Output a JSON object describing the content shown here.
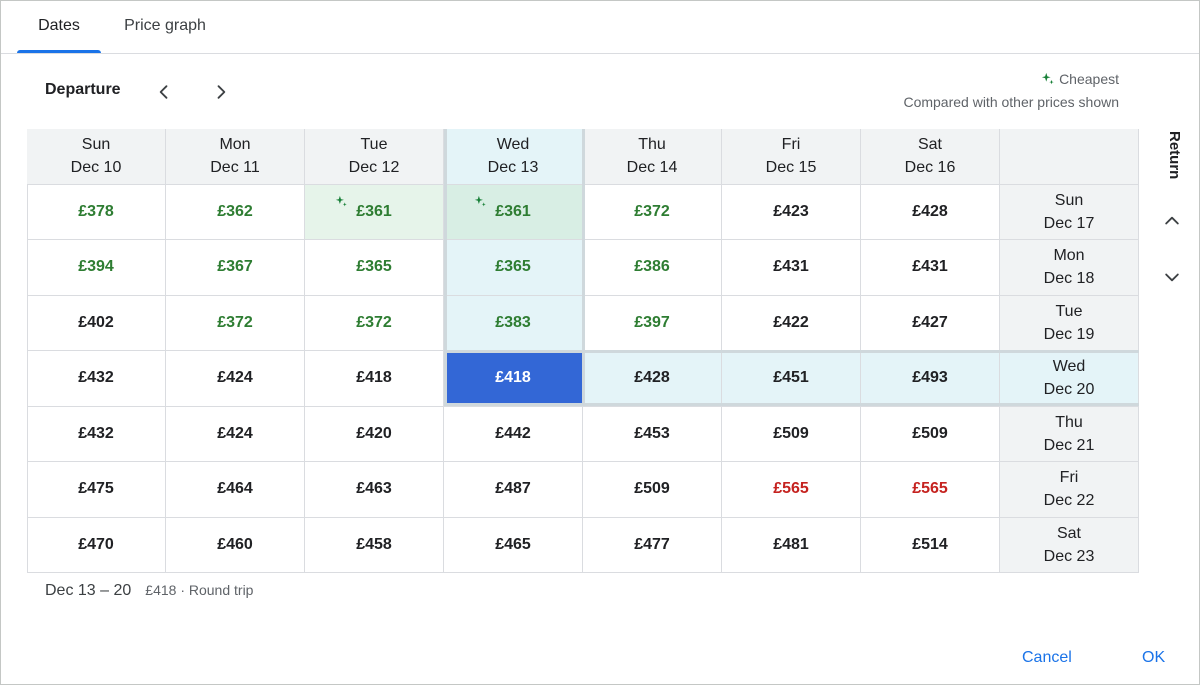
{
  "tabs": [
    {
      "label": "Dates",
      "active": true
    },
    {
      "label": "Price graph",
      "active": false
    }
  ],
  "departure": {
    "label": "Departure",
    "prev_icon": "chevron-left-icon",
    "next_icon": "chevron-right-icon"
  },
  "legend": {
    "icon": "sparkle-icon",
    "cheapest_label": "Cheapest",
    "note": "Compared with other prices shown"
  },
  "columns": [
    {
      "day": "Sun",
      "date": "Dec 10"
    },
    {
      "day": "Mon",
      "date": "Dec 11"
    },
    {
      "day": "Tue",
      "date": "Dec 12"
    },
    {
      "day": "Wed",
      "date": "Dec 13"
    },
    {
      "day": "Thu",
      "date": "Dec 14"
    },
    {
      "day": "Fri",
      "date": "Dec 15"
    },
    {
      "day": "Sat",
      "date": "Dec 16"
    }
  ],
  "rows": [
    {
      "day": "Sun",
      "date": "Dec 17",
      "prices": [
        "£378",
        "£362",
        "£361",
        "£361",
        "£372",
        "£423",
        "£428"
      ],
      "levels": [
        "low",
        "low",
        "cheapest",
        "cheapest",
        "low",
        "normal",
        "normal"
      ]
    },
    {
      "day": "Mon",
      "date": "Dec 18",
      "prices": [
        "£394",
        "£367",
        "£365",
        "£365",
        "£386",
        "£431",
        "£431"
      ],
      "levels": [
        "low",
        "low",
        "low",
        "low",
        "low",
        "normal",
        "normal"
      ]
    },
    {
      "day": "Tue",
      "date": "Dec 19",
      "prices": [
        "£402",
        "£372",
        "£372",
        "£383",
        "£397",
        "£422",
        "£427"
      ],
      "levels": [
        "normal",
        "low",
        "low",
        "low",
        "low",
        "normal",
        "normal"
      ]
    },
    {
      "day": "Wed",
      "date": "Dec 20",
      "prices": [
        "£432",
        "£424",
        "£418",
        "£418",
        "£428",
        "£451",
        "£493"
      ],
      "levels": [
        "normal",
        "normal",
        "normal",
        "selected",
        "normal",
        "normal",
        "normal"
      ]
    },
    {
      "day": "Thu",
      "date": "Dec 21",
      "prices": [
        "£432",
        "£424",
        "£420",
        "£442",
        "£453",
        "£509",
        "£509"
      ],
      "levels": [
        "normal",
        "normal",
        "normal",
        "normal",
        "normal",
        "normal",
        "normal"
      ]
    },
    {
      "day": "Fri",
      "date": "Dec 22",
      "prices": [
        "£475",
        "£464",
        "£463",
        "£487",
        "£509",
        "£565",
        "£565"
      ],
      "levels": [
        "normal",
        "normal",
        "normal",
        "normal",
        "normal",
        "high",
        "high"
      ]
    },
    {
      "day": "Sat",
      "date": "Dec 23",
      "prices": [
        "£470",
        "£460",
        "£458",
        "£465",
        "£477",
        "£481",
        "£514"
      ],
      "levels": [
        "normal",
        "normal",
        "normal",
        "normal",
        "normal",
        "normal",
        "normal"
      ]
    }
  ],
  "selection": {
    "column_index": 3,
    "row_index": 3
  },
  "return": {
    "label": "Return",
    "up_icon": "chevron-up-icon",
    "down_icon": "chevron-down-icon"
  },
  "summary": {
    "dates": "Dec 13 – 20",
    "price": "£418 · Round trip"
  },
  "footer": {
    "cancel_label": "Cancel",
    "ok_label": "OK"
  },
  "colors": {
    "accent": "#1a73e8",
    "selected_cell": "#3367d6",
    "low_price": "#2e7d32",
    "high_price": "#c5221f",
    "highlight": "#e4f4f8",
    "cheapest_bg": "#e6f4ea"
  }
}
